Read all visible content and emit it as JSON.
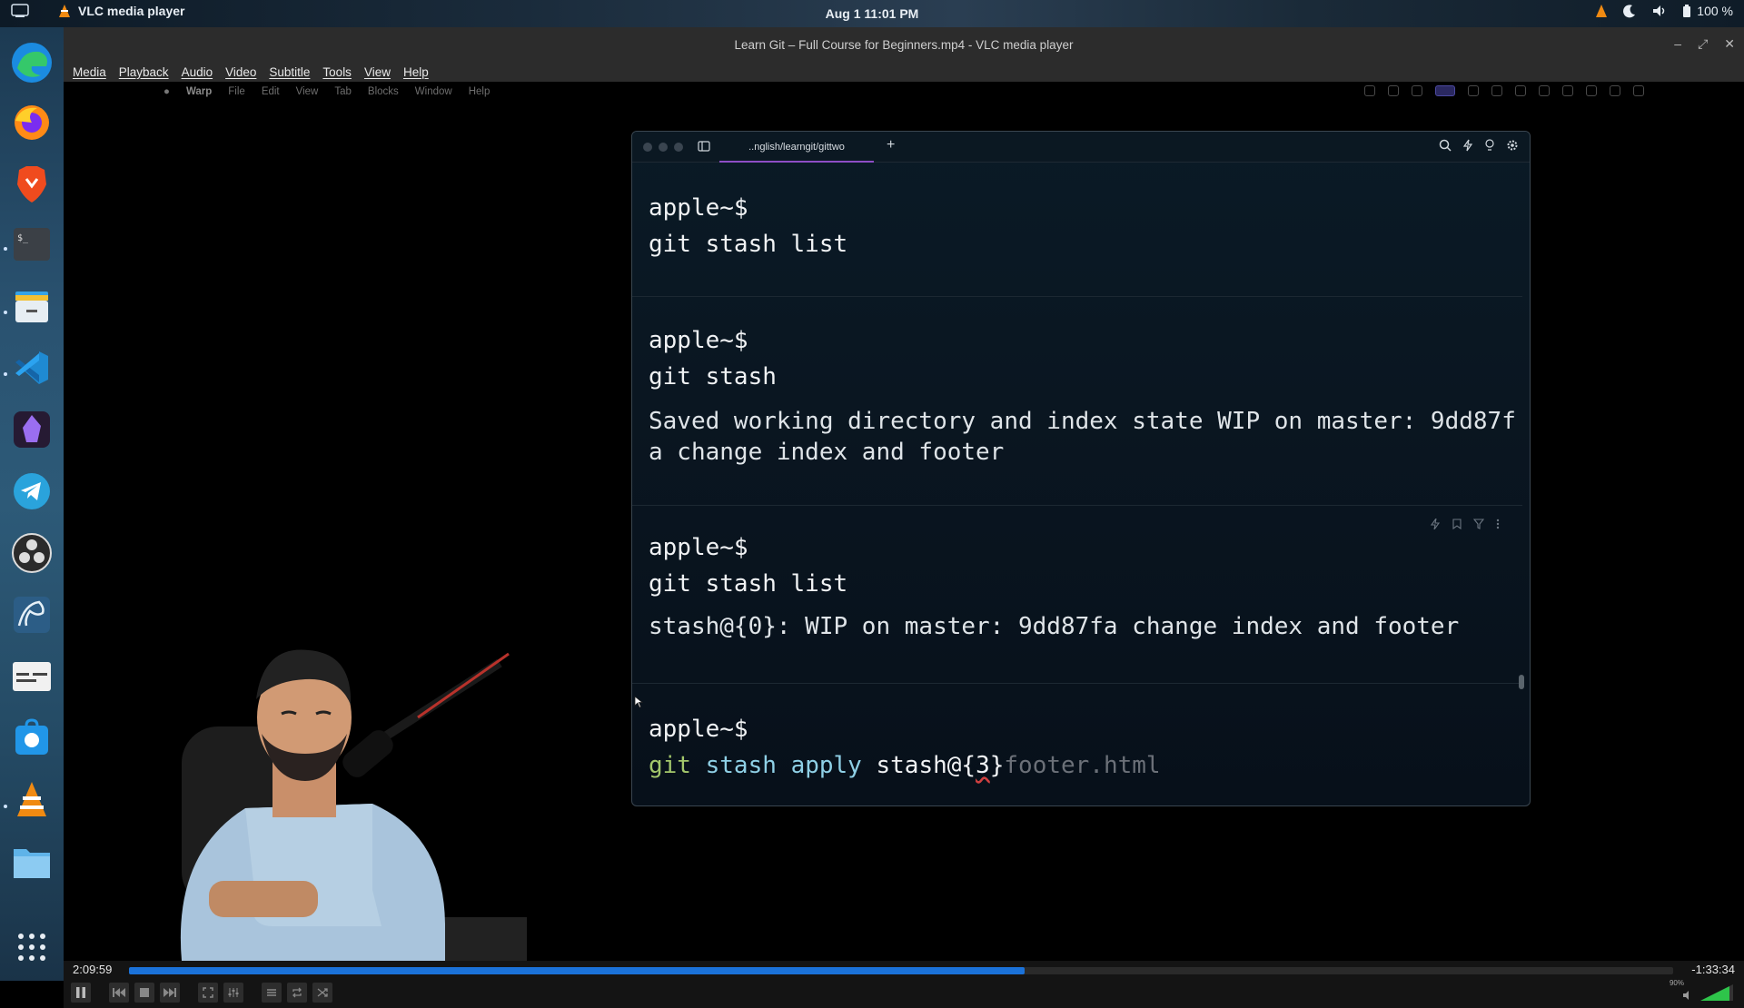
{
  "system_bar": {
    "app_name": "VLC media player",
    "clock": "Aug 1  11:01 PM",
    "battery": "100 %"
  },
  "vlc": {
    "window_title": "Learn Git – Full Course for Beginners.mp4 - VLC media player",
    "menu": [
      "Media",
      "Playback",
      "Audio",
      "Video",
      "Subtitle",
      "Tools",
      "View",
      "Help"
    ],
    "time_elapsed": "2:09:59",
    "time_remaining": "-1:33:34",
    "progress_fraction": 0.58,
    "volume_percent": "90%"
  },
  "mac_menu": {
    "app": "Warp",
    "items": [
      "File",
      "Edit",
      "View",
      "Tab",
      "Blocks",
      "Window",
      "Help"
    ]
  },
  "warp": {
    "tab_title": "..nglish/learngit/gittwo",
    "plus": "+",
    "blocks": [
      {
        "prompt": "apple~$",
        "command": "git stash list",
        "output": []
      },
      {
        "prompt": "apple~$",
        "command": "git stash",
        "output": [
          "Saved working directory and index state WIP on master: 9dd87f",
          "a change index and footer"
        ]
      },
      {
        "prompt": "apple~$",
        "command": "git stash list",
        "output": [
          "stash@{0}: WIP on master: 9dd87fa change index and footer"
        ]
      }
    ],
    "active": {
      "prompt": "apple~$",
      "cmd_git": "git",
      "cmd_stash": "stash",
      "cmd_apply": "apply",
      "cmd_arg_pre": "stash@{",
      "cmd_arg_num": "3",
      "cmd_arg_post": "}",
      "suggestion": "footer.html"
    }
  },
  "colors": {
    "accent": "#1b72d9",
    "tab_underline": "#8e4ec6"
  }
}
